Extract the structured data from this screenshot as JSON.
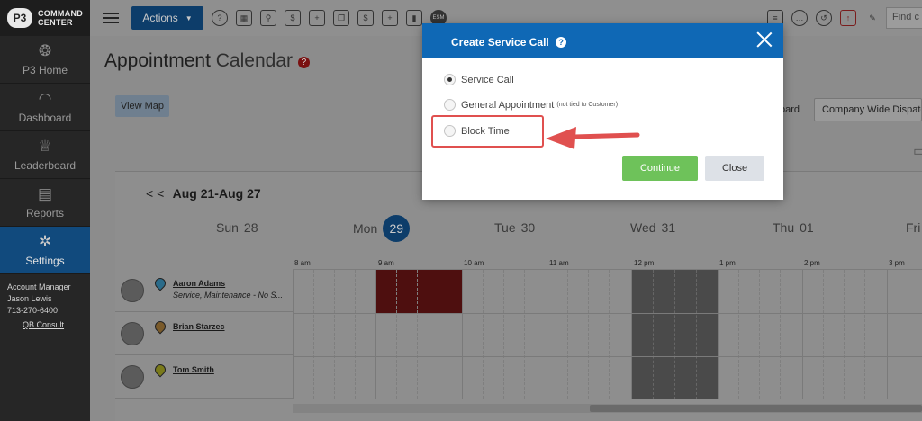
{
  "brand": {
    "badge": "P3",
    "line1": "COMMAND",
    "line2": "CENTER"
  },
  "sidebar": {
    "items": [
      {
        "label": "P3 Home",
        "icon": "p3-home-icon"
      },
      {
        "label": "Dashboard",
        "icon": "gauge-icon"
      },
      {
        "label": "Leaderboard",
        "icon": "trophy-icon"
      },
      {
        "label": "Reports",
        "icon": "report-icon"
      },
      {
        "label": "Settings",
        "icon": "gear-icon"
      }
    ],
    "account": {
      "role": "Account Manager",
      "name": "Jason Lewis",
      "phone": "713-270-6400",
      "link": "QB Consult"
    }
  },
  "topbar": {
    "actions_label": "Actions",
    "esm_label": "ESM",
    "find_placeholder": "Find c"
  },
  "page": {
    "title_main": "Appointment",
    "title_sub": "Calendar",
    "help_badge": "?",
    "view_map": "View Map",
    "board_label": "oard",
    "dispatch_value": "Company Wide Dispatch"
  },
  "calendar": {
    "week_range": "Aug 21-Aug 27",
    "nav_prev": "< <",
    "days": [
      {
        "name": "Sun",
        "num": "28"
      },
      {
        "name": "Mon",
        "num": "29"
      },
      {
        "name": "Tue",
        "num": "30"
      },
      {
        "name": "Wed",
        "num": "31"
      },
      {
        "name": "Thu",
        "num": "01"
      },
      {
        "name": "Fri",
        "num": ""
      }
    ],
    "hours": [
      "8 am",
      "9 am",
      "10 am",
      "11 am",
      "12 pm",
      "1 pm",
      "2 pm",
      "3 pm"
    ],
    "technicians": [
      {
        "name": "Aaron Adams",
        "sub": "Service, Maintenance - No S...",
        "pin_color": "#2a6b8a"
      },
      {
        "name": "Brian Starzec",
        "sub": "",
        "pin_color": "#7a5a2a"
      },
      {
        "name": "Tom Smith",
        "sub": "",
        "pin_color": "#7a7a1a"
      }
    ]
  },
  "modal": {
    "title": "Create Service Call",
    "help": "?",
    "options": [
      {
        "label": "Service Call",
        "note": "",
        "checked": true
      },
      {
        "label": "General Appointment",
        "note": "(not tied to Customer)",
        "checked": false
      },
      {
        "label": "Block Time",
        "note": "",
        "checked": false
      }
    ],
    "continue_label": "Continue",
    "close_label": "Close"
  }
}
